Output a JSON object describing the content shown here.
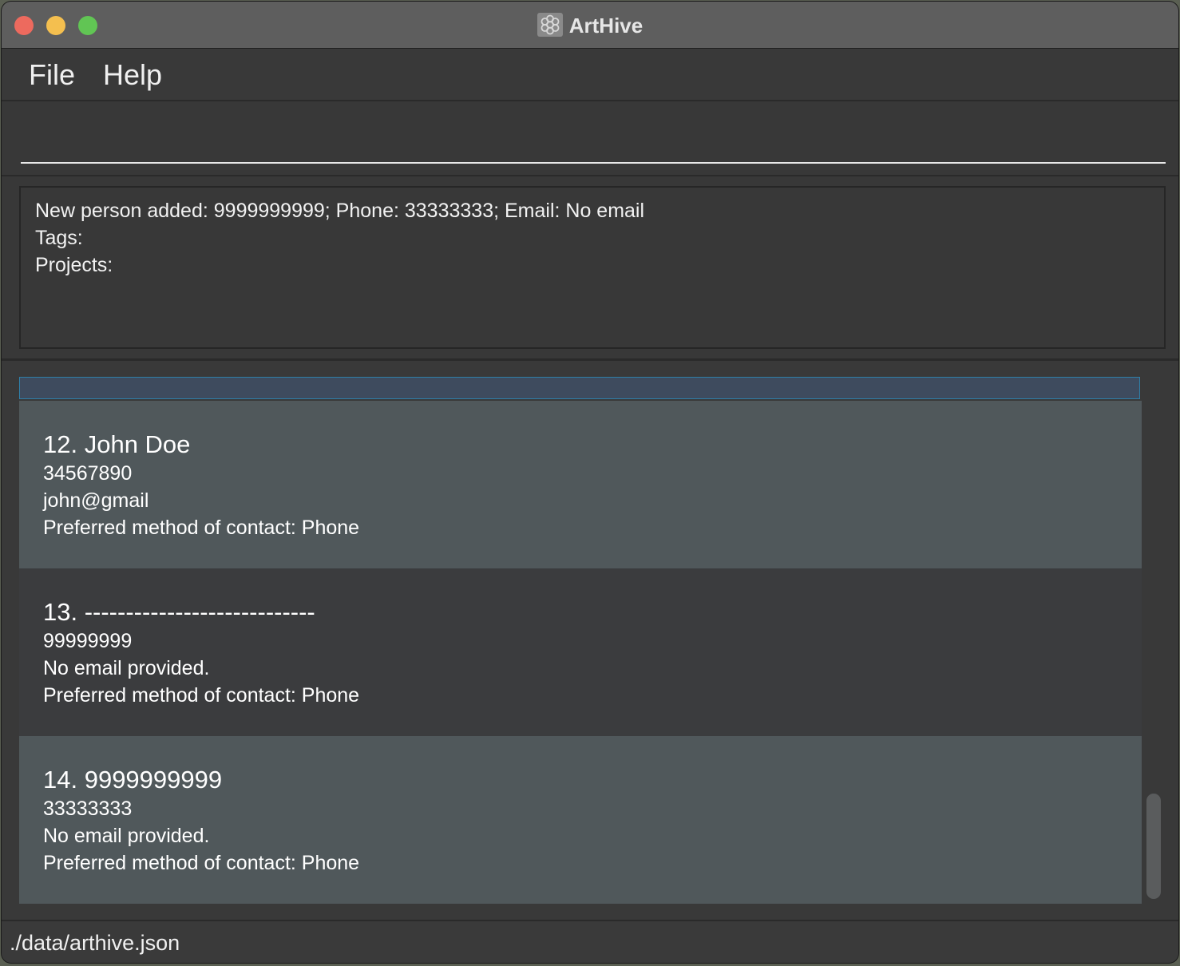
{
  "window": {
    "title": "ArtHive",
    "icon": "arthive-logo-icon"
  },
  "menu": {
    "items": [
      {
        "label": "File"
      },
      {
        "label": "Help"
      }
    ]
  },
  "command": {
    "value": "",
    "placeholder": ""
  },
  "result": {
    "lines": [
      "New person added: 9999999999; Phone: 33333333; Email: No email",
      "Tags:",
      "Projects:"
    ]
  },
  "persons": [
    {
      "title": "12. John Doe",
      "phone": "34567890",
      "email": "john@gmail",
      "contact": "Preferred method of contact: Phone"
    },
    {
      "title": "13. ----------------------------",
      "phone": "99999999",
      "email": "No email provided.",
      "contact": "Preferred method of contact: Phone"
    },
    {
      "title": "14. 9999999999",
      "phone": "33333333",
      "email": "No email provided.",
      "contact": "Preferred method of contact: Phone"
    }
  ],
  "status": {
    "file_path": "./data/arthive.json"
  },
  "colors": {
    "card_light": "#50585b",
    "card_dark": "#3b3c3e",
    "selected_card": "#3e4b5e",
    "background": "#393939"
  }
}
